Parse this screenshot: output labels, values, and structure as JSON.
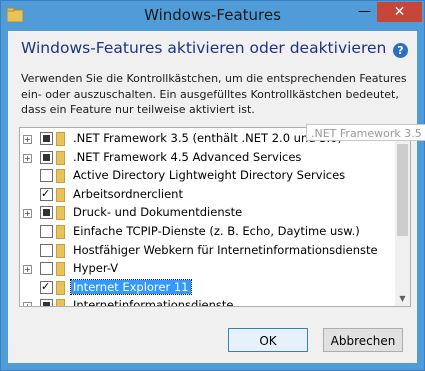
{
  "window": {
    "title": "Windows-Features",
    "close_glyph": "✕",
    "minimize_glyph": "—"
  },
  "dialog": {
    "heading": "Windows-Features aktivieren oder deaktivieren",
    "description": "Verwenden Sie die Kontrollkästchen, um die entsprechenden Features ein- oder auszuschalten. Ein ausgefülltes Kontrollkästchen bedeutet, dass ein Feature nur teilweise aktiviert ist.",
    "help_glyph": "?"
  },
  "features": [
    {
      "label": ".NET Framework 3.5 (enthält .NET 2.0 und 3.0)",
      "expandable": true,
      "state": "partial"
    },
    {
      "label": ".NET Framework 4.5 Advanced Services",
      "expandable": true,
      "state": "partial"
    },
    {
      "label": "Active Directory Lightweight Directory Services",
      "expandable": false,
      "state": "unchecked"
    },
    {
      "label": "Arbeitsordnerclient",
      "expandable": false,
      "state": "checked"
    },
    {
      "label": "Druck- und Dokumentdienste",
      "expandable": true,
      "state": "partial"
    },
    {
      "label": "Einfache TCPIP-Dienste (z. B. Echo, Daytime usw.)",
      "expandable": false,
      "state": "unchecked"
    },
    {
      "label": "Hostfähiger Webkern für Internetinformationsdienste",
      "expandable": false,
      "state": "unchecked"
    },
    {
      "label": "Hyper-V",
      "expandable": true,
      "state": "unchecked"
    },
    {
      "label": "Internet Explorer 11",
      "expandable": false,
      "state": "checked",
      "selected": true
    },
    {
      "label": "Internetinformationsdienste",
      "expandable": true,
      "state": "partial"
    }
  ],
  "tooltip": ".NET Framework 3.5",
  "buttons": {
    "ok": "OK",
    "cancel": "Abbrechen"
  },
  "colors": {
    "accent_title": "#4f9cd9",
    "heading": "#1e3287",
    "selection": "#3399ff",
    "close": "#c7463a"
  }
}
